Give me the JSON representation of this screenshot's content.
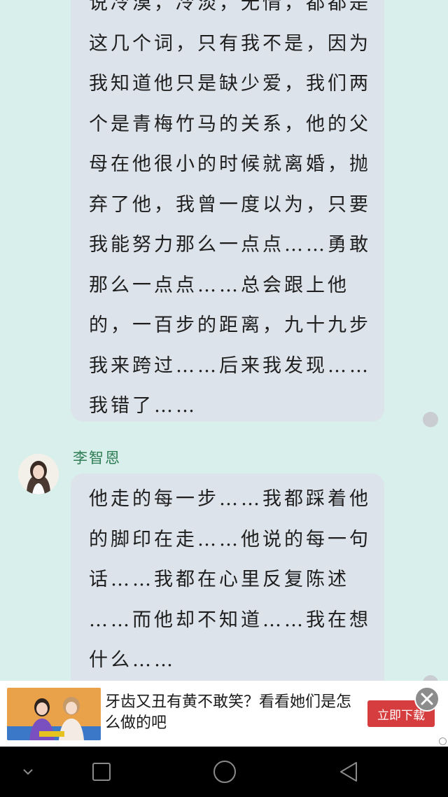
{
  "conversation": {
    "message_1": {
      "lines": [
        "说冷漠，冷淡，无情，都都是",
        "这几个词，只有我不是，因为",
        "我知道他只是缺少爱，我们两",
        "个是青梅竹马的关系，他的父",
        "母在他很小的时候就离婚，抛",
        "弃了他，我曾一度以为，只要",
        "我能努力那么一点点……勇敢",
        "那么一点点……总会跟上他",
        "的，一百步的距离，九十九步",
        "我来跨过……后来我发现……",
        "我错了……"
      ]
    },
    "message_2": {
      "sender": "李智恩",
      "lines": [
        "他走的每一步……我都踩着他",
        "的脚印在走……他说的每一句",
        "话……我都在心里反复陈述",
        "……而他却不知道……我在想",
        "什么……"
      ]
    }
  },
  "ad": {
    "text": "牙齿又丑有黄不敢笑？看看她们是怎么做的吧",
    "cta": "立即下载"
  },
  "colors": {
    "background": "#d9efeb",
    "bubble": "#dde3ea",
    "sender_name": "#2f7d55",
    "cta": "#d63d3f"
  },
  "icons": {
    "close": "close-icon",
    "nav_hide": "chevron-down-icon",
    "nav_recent": "square-icon",
    "nav_home": "circle-icon",
    "nav_back": "triangle-back-icon"
  }
}
